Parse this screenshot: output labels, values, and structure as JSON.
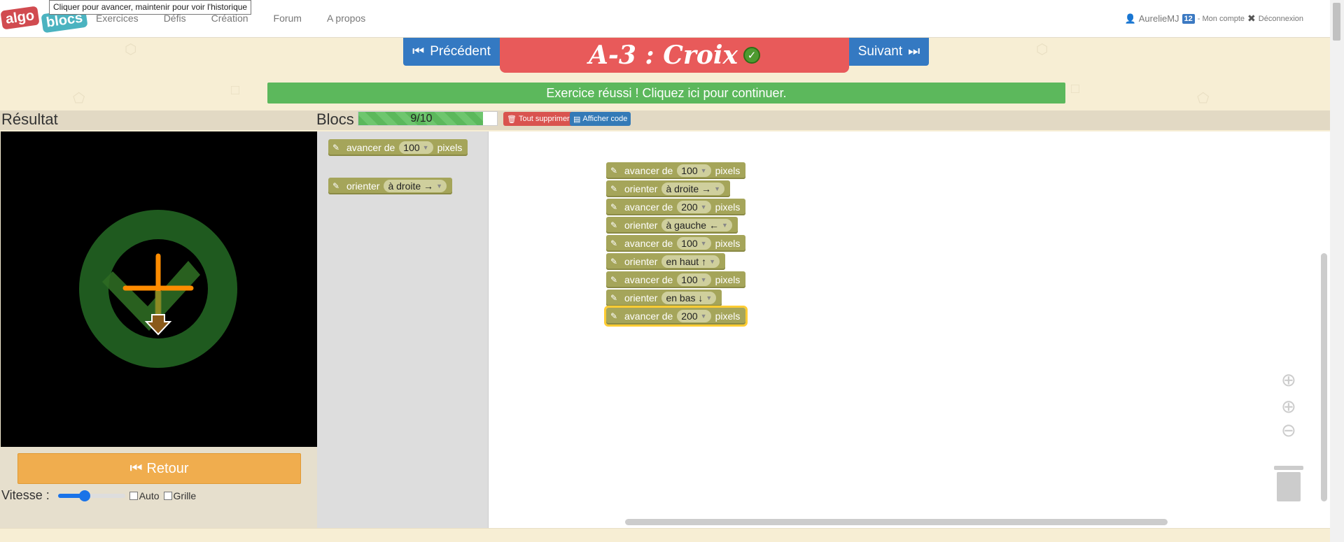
{
  "logo": {
    "part1": "algo",
    "part2": "blocs"
  },
  "tooltip": "Cliquer pour avancer, maintenir pour voir l'historique",
  "nav": {
    "items": [
      {
        "label": "Exercices"
      },
      {
        "label": "Défis"
      },
      {
        "label": "Création"
      },
      {
        "label": "Forum"
      },
      {
        "label": "A propos"
      }
    ]
  },
  "user": {
    "name": "AurelieMJ",
    "badge": "12",
    "account": "- Mon compte",
    "logout": "Déconnexion"
  },
  "exercise": {
    "prev_label": "Précédent",
    "next_label": "Suivant",
    "title": "A-3 : Croix",
    "success": "Exercice réussi ! Cliquez ici pour continuer."
  },
  "panels": {
    "result": "Résultat",
    "blocks": "Blocs"
  },
  "progress": {
    "label": "9/10",
    "fraction": 0.9
  },
  "buttons": {
    "delete_all": "Tout supprimer",
    "show_code": "Afficher code",
    "back": "Retour"
  },
  "speed": {
    "label": "Vitesse :",
    "value": 0.4,
    "auto": "Auto",
    "grid": "Grille"
  },
  "toolbox": [
    {
      "verb": "avancer de",
      "value": "100",
      "suffix": "pixels"
    },
    {
      "verb": "orienter",
      "value": "à droite →",
      "suffix": ""
    }
  ],
  "program": [
    {
      "verb": "avancer de",
      "value": "100",
      "suffix": "pixels"
    },
    {
      "verb": "orienter",
      "value": "à droite →",
      "suffix": ""
    },
    {
      "verb": "avancer de",
      "value": "200",
      "suffix": "pixels"
    },
    {
      "verb": "orienter",
      "value": "à gauche ←",
      "suffix": ""
    },
    {
      "verb": "avancer de",
      "value": "100",
      "suffix": "pixels"
    },
    {
      "verb": "orienter",
      "value": "en haut ↑",
      "suffix": ""
    },
    {
      "verb": "avancer de",
      "value": "100",
      "suffix": "pixels"
    },
    {
      "verb": "orienter",
      "value": "en bas ↓",
      "suffix": ""
    },
    {
      "verb": "avancer de",
      "value": "200",
      "suffix": "pixels"
    }
  ],
  "colors": {
    "primary": "#3479c2",
    "title_bg": "#e85a5a",
    "success": "#5cb85c",
    "block": "#a5a55a",
    "retour": "#f0ad4e",
    "path": "#ff8c00"
  }
}
